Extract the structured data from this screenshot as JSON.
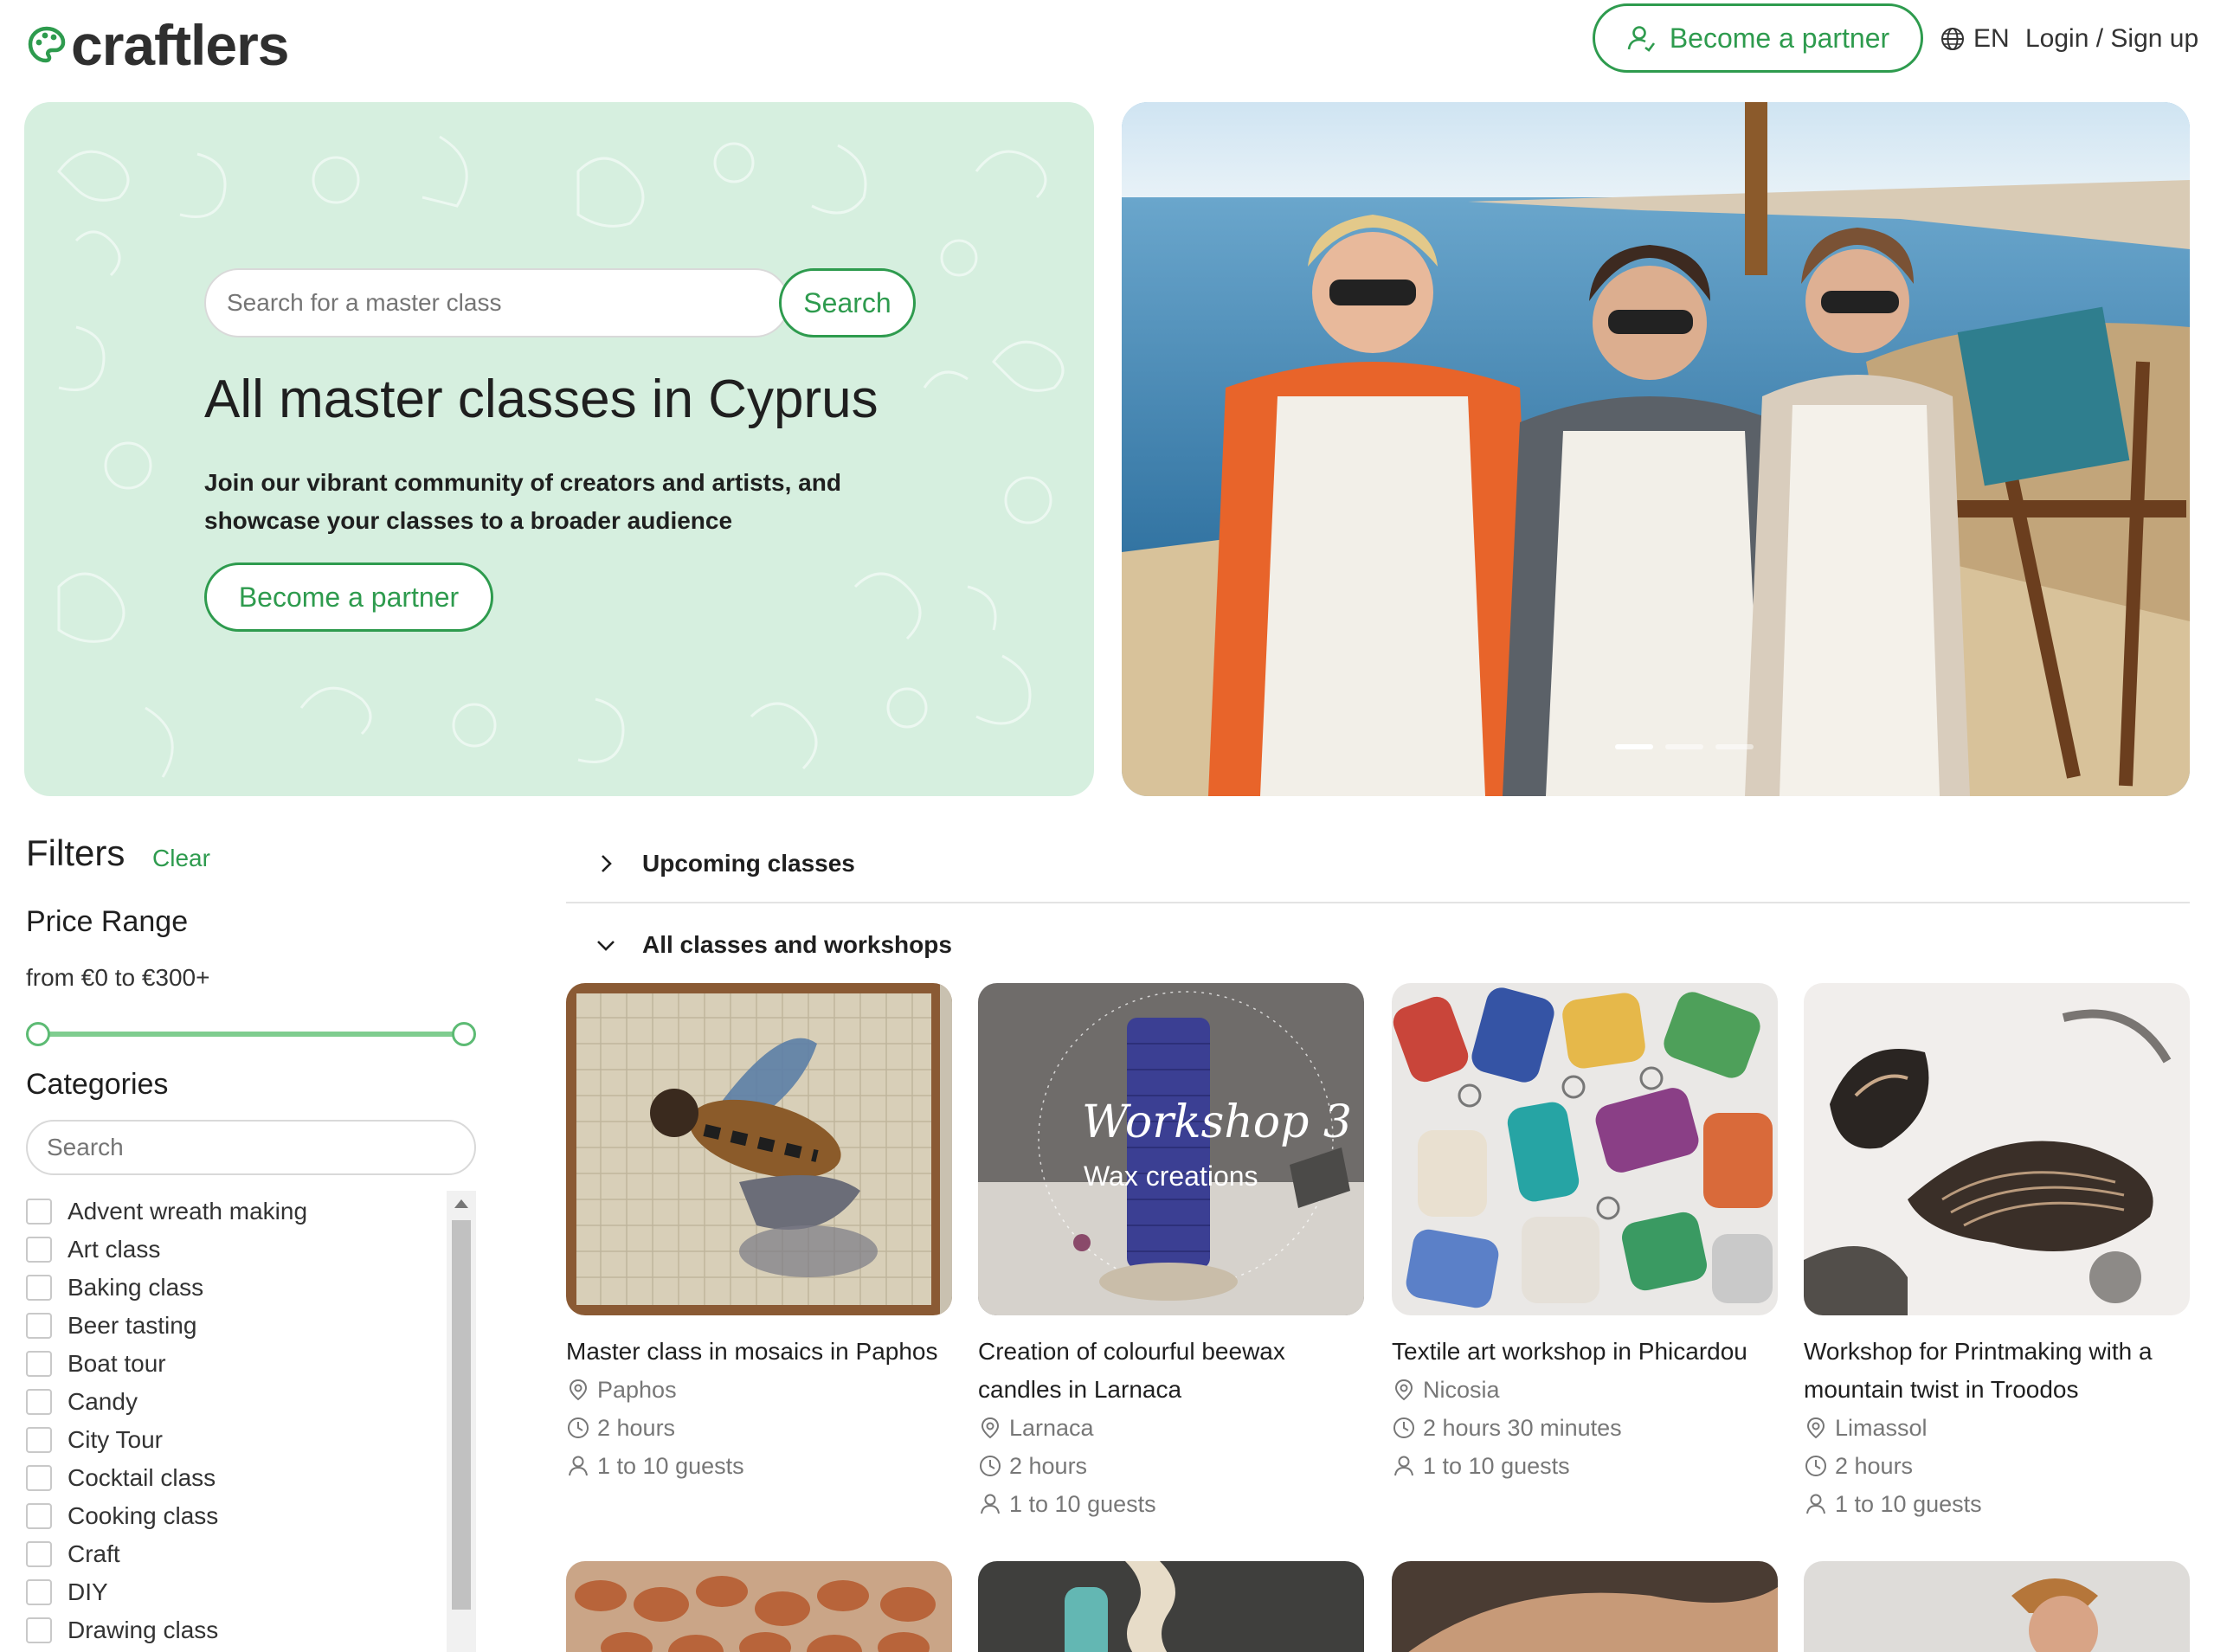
{
  "header": {
    "logo_text": "craftlers",
    "become_partner": "Become a partner",
    "language": "EN",
    "login": "Login / Sign up"
  },
  "hero": {
    "search_placeholder": "Search for a master class",
    "search_button": "Search",
    "title": "All master classes in Cyprus",
    "subtitle": "Join our vibrant community of creators and artists, and showcase your classes to a broader audience",
    "partner_button": "Become a partner",
    "carousel_dots": 3,
    "carousel_active": 0
  },
  "filters": {
    "title": "Filters",
    "clear": "Clear",
    "price_title": "Price Range",
    "price_text": "from €0 to €300+",
    "categories_title": "Categories",
    "categories_search_placeholder": "Search",
    "categories": [
      "Advent wreath making",
      "Art class",
      "Baking class",
      "Beer tasting",
      "Boat tour",
      "Candy",
      "City Tour",
      "Cocktail class",
      "Cooking class",
      "Craft",
      "DIY",
      "Drawing class"
    ]
  },
  "sections": {
    "upcoming": "Upcoming classes",
    "all": "All classes and workshops"
  },
  "cards": [
    {
      "title": "Master class in mosaics in Paphos",
      "location": "Paphos",
      "duration": "2 hours",
      "guests": "1 to 10 guests"
    },
    {
      "title": "Creation of colourful beewax candles in Larnaca",
      "location": "Larnaca",
      "duration": "2 hours",
      "guests": "1 to 10 guests",
      "image_text_1": "Workshop 3",
      "image_text_2": "Wax creations"
    },
    {
      "title": "Textile art workshop in Phicardou",
      "location": "Nicosia",
      "duration": "2 hours 30 minutes",
      "guests": "1 to 10 guests"
    },
    {
      "title": "Workshop for Printmaking with a mountain twist in Troodos",
      "location": "Limassol",
      "duration": "2 hours",
      "guests": "1 to 10 guests"
    }
  ],
  "colors": {
    "accent": "#2e9b4e",
    "hero_bg": "#d6efdf",
    "slider": "#7fcd8f"
  }
}
